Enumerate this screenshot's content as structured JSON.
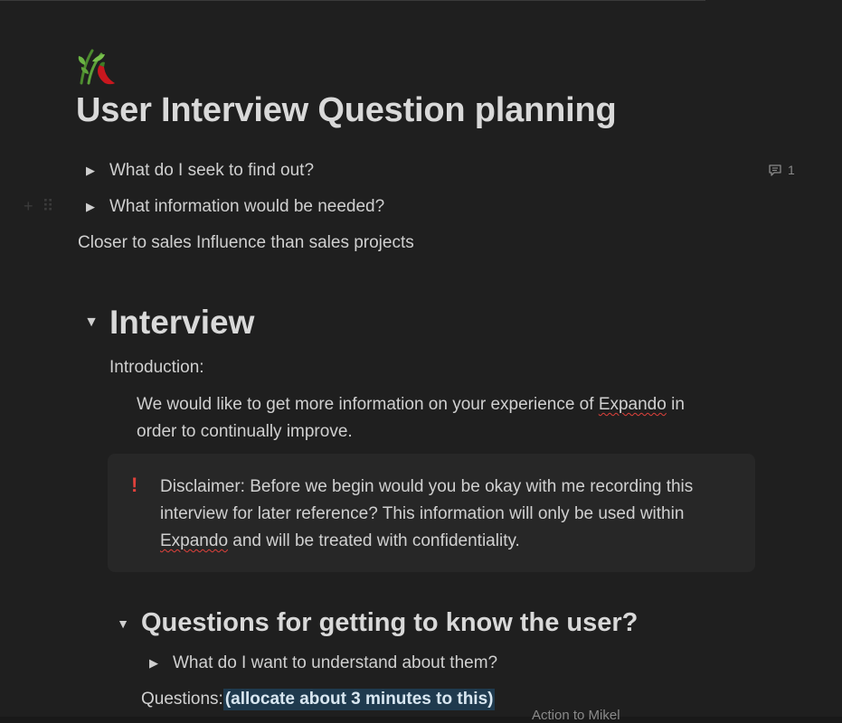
{
  "page": {
    "icon": "hot-pepper-and-leaves-icon",
    "title": "User Interview Question planning"
  },
  "toggles": [
    {
      "label": "What do I seek to find out?"
    },
    {
      "label": "What information would be needed?"
    }
  ],
  "comment": {
    "count": "1"
  },
  "note": "Closer to sales Influence than sales projects",
  "interview": {
    "heading": "Interview",
    "intro_label": "Introduction:",
    "intro_part1": "We would like to get more information on your experience of ",
    "intro_brand": "Expando",
    "intro_part2": " in",
    "intro_line2": "order to continually improve.",
    "callout": {
      "icon": "!",
      "line1": "Disclaimer: Before we begin would you be okay with me recording this",
      "line2": "interview for later reference? This information will only be used within",
      "line3_brand": "Expando",
      "line3_rest": " and will be treated with confidentiality."
    }
  },
  "section": {
    "heading": "Questions for getting to know the user?",
    "toggle_label": "What do I want to understand about them?",
    "questions_label": "Questions: ",
    "questions_highlight": "(allocate about 3 minutes to this)",
    "cut_off_text": "Action to Mikel"
  },
  "colors": {
    "background": "#1f1f1f",
    "text": "#d0d0d0",
    "accent_red": "#e0413b",
    "highlight_bg": "#1f3a4e",
    "callout_bg": "#272727"
  }
}
